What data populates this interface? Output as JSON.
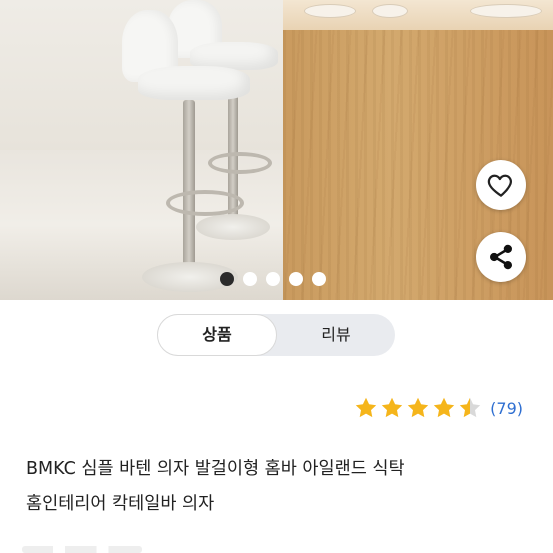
{
  "product": {
    "title_line1": "BMKC 심플 바텐 의자 발걸이형 홈바 아일랜드 식탁",
    "title_line2": "홈인테리어 칵테일바 의자",
    "rating_stars": 4.5,
    "review_count": "(79)"
  },
  "gallery": {
    "current_index": 1,
    "total_dots": 5,
    "icons": [
      "heart-icon",
      "share-icon"
    ]
  },
  "tabs": [
    {
      "label": "상품",
      "active": true
    },
    {
      "label": "리뷰",
      "active": false
    }
  ],
  "colors": {
    "star": "#f5b51b",
    "review_count": "#2f6fd1",
    "active_dot": "#2b2b2b",
    "tab_track": "#e9ebef"
  }
}
